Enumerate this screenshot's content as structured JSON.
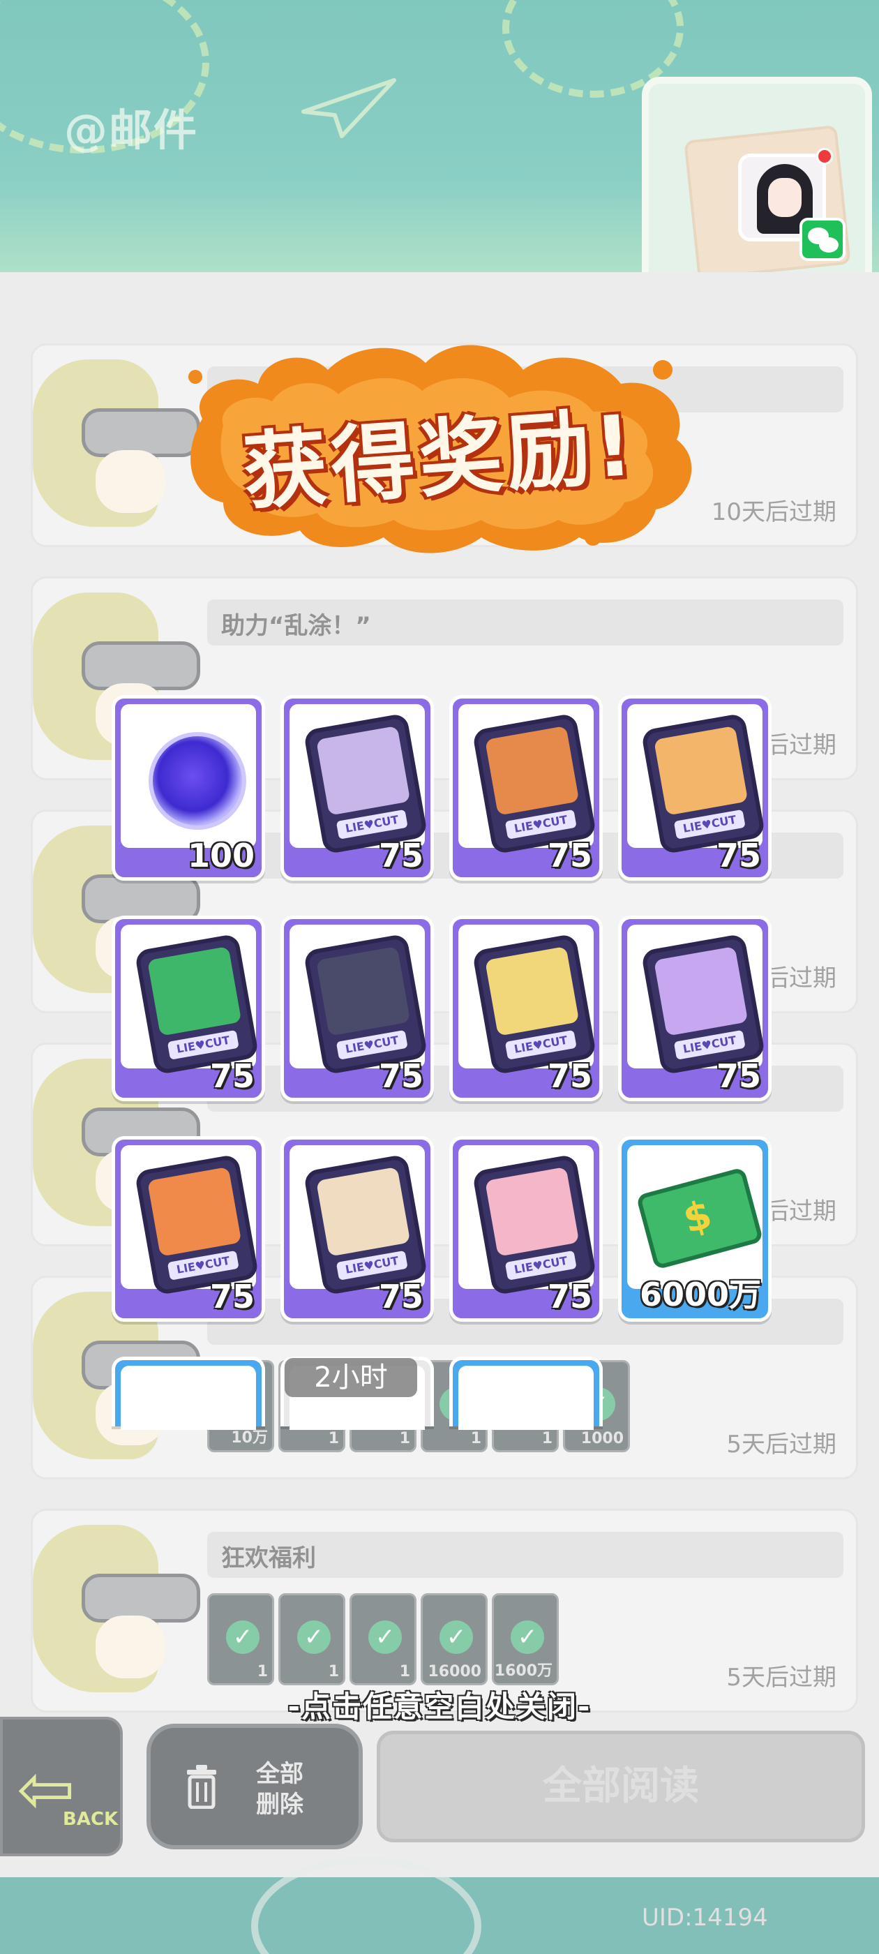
{
  "header": {
    "page_title": "@邮件"
  },
  "mails": [
    {
      "title": "",
      "expire": "10天后过期",
      "attachments": []
    },
    {
      "title": "助力“乱涂！”",
      "expire": "5天后过期",
      "attachments": []
    },
    {
      "title": "",
      "expire": "5天后过期",
      "attachments": []
    },
    {
      "title": "",
      "expire": "5天后过期",
      "attachments": []
    },
    {
      "title": "",
      "expire": "5天后过期",
      "attachments": [
        "10万",
        "1",
        "1",
        "1",
        "1",
        "1000"
      ]
    },
    {
      "title": "狂欢福利",
      "expire": "5天后过期",
      "attachments": [
        "1",
        "1",
        "1",
        "16000",
        "1600万"
      ]
    }
  ],
  "reward": {
    "title": "获得奖励!",
    "items": [
      {
        "icon": "orb-icon",
        "qty": "100"
      },
      {
        "icon": "character-card-icon",
        "qty": "75",
        "color": "#c9b6e8"
      },
      {
        "icon": "character-card-icon",
        "qty": "75",
        "color": "#e58a4a"
      },
      {
        "icon": "character-card-icon",
        "qty": "75",
        "color": "#f2b56a"
      },
      {
        "icon": "character-card-icon",
        "qty": "75",
        "color": "#3fb76a"
      },
      {
        "icon": "character-card-icon",
        "qty": "75",
        "color": "#4a4a6a"
      },
      {
        "icon": "character-card-icon",
        "qty": "75",
        "color": "#f2d77a"
      },
      {
        "icon": "character-card-icon",
        "qty": "75",
        "color": "#c7a8f0"
      },
      {
        "icon": "character-card-icon",
        "qty": "75",
        "color": "#f08a4a"
      },
      {
        "icon": "character-card-icon",
        "qty": "75",
        "color": "#f0dcc0"
      },
      {
        "icon": "character-card-icon",
        "qty": "75",
        "color": "#f4b6c8"
      },
      {
        "icon": "cash-icon",
        "qty": "6000万"
      }
    ],
    "card_tag": "LIE♥CUT",
    "timer": "2小时",
    "close_hint": "-点击任意空白处关闭-"
  },
  "bottom_bar": {
    "back_label": "BACK",
    "delete_label": "全部删除",
    "read_all_label": "全部阅读"
  },
  "uid": "UID:14194",
  "colors": {
    "accent_purple": "#8c6be6",
    "accent_blue": "#4aa8ef",
    "banner_orange": "#f08a1c"
  }
}
